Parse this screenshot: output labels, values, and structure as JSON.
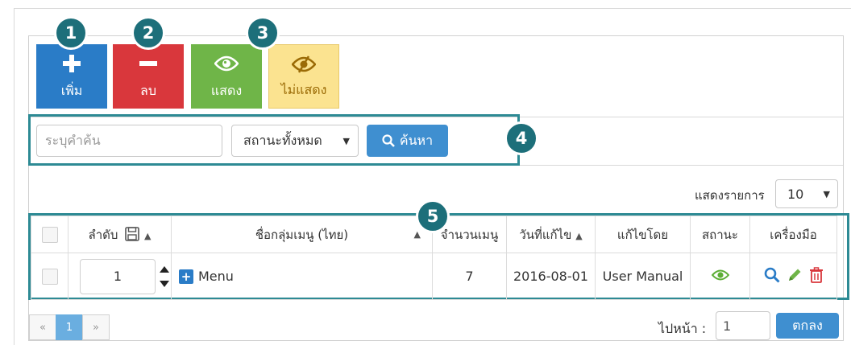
{
  "toolbar": {
    "add_label": "เพิ่ม",
    "delete_label": "ลบ",
    "show_label": "แสดง",
    "hide_label": "ไม่แสดง"
  },
  "badges": [
    "1",
    "2",
    "3",
    "4",
    "5"
  ],
  "filter": {
    "search_placeholder": "ระบุคำค้น",
    "status_selected": "สถานะทั้งหมด",
    "search_button": "ค้นหา"
  },
  "page_size": {
    "label": "แสดงรายการ",
    "value": "10"
  },
  "table": {
    "headers": {
      "order": "ลำดับ",
      "name": "ชื่อกลุ่มเมนู (ไทย)",
      "count": "จำนวนเมนู",
      "date": "วันที่แก้ไข",
      "editor": "แก้ไขโดย",
      "status": "สถานะ",
      "tools": "เครื่องมือ"
    },
    "rows": [
      {
        "order": "1",
        "name": "Menu",
        "count": "7",
        "date": "2016-08-01",
        "editor": "User Manual"
      }
    ]
  },
  "pagination": {
    "prev": "«",
    "current": "1",
    "next": "»"
  },
  "goto": {
    "label": "ไปหน้า :",
    "value": "1",
    "button": "ตกลง"
  },
  "colors": {
    "add": "#2a7cc7",
    "delete": "#d9373c",
    "show": "#6fb548",
    "hide": "#fbe390",
    "highlight": "#2d8a94",
    "badge": "#1d6f7a"
  }
}
